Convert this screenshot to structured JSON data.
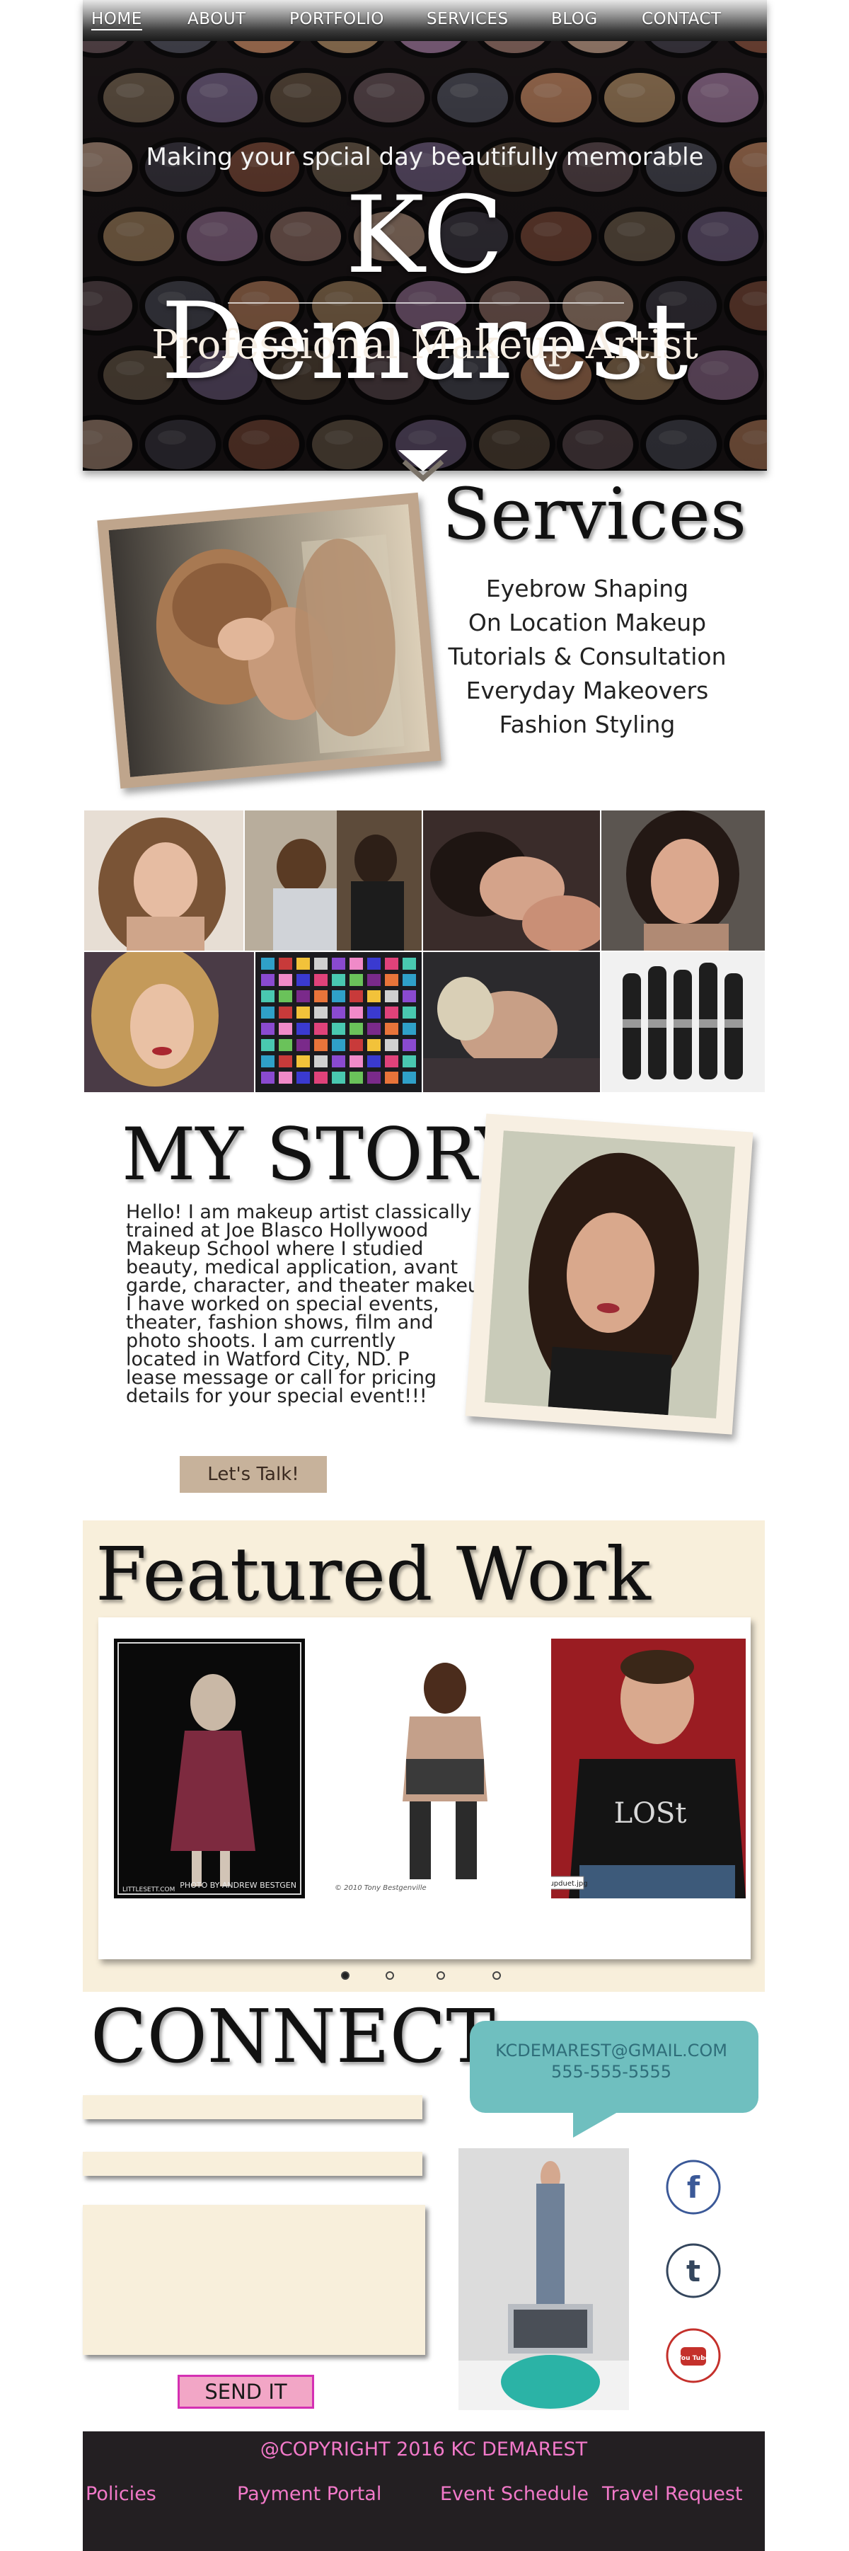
{
  "nav": {
    "items": [
      {
        "label": "HOME"
      },
      {
        "label": "ABOUT"
      },
      {
        "label": "PORTFOLIO"
      },
      {
        "label": "SERVICES"
      },
      {
        "label": "BLOG"
      },
      {
        "label": "CONTACT"
      }
    ],
    "active": "HOME"
  },
  "hero": {
    "tagline": "Making your spcial day beautifully memorable",
    "title": "KC Demarest",
    "subtitle": "Professional Makeup Artist"
  },
  "services": {
    "title": "Services",
    "items": [
      "Eyebrow Shaping",
      "On Location Makeup",
      "Tutorials & Consultation",
      "Everyday Makeovers",
      "Fashion Styling"
    ]
  },
  "story": {
    "title": "MY STORY",
    "lines": [
      "Hello! I am makeup artist classically",
      "trained at Joe Blasco Hollywood",
      "Makeup School where I studied",
      "beauty, medical application, avant",
      " garde, character, and theater makeup.",
      "I have worked on special events,",
      "theater, fashion shows, film and",
      " photo shoots. I am currently",
      "located in Watford City, ND. P",
      "lease message or call for pricing",
      "details for your special event!!!"
    ],
    "button_label": "Let's Talk!"
  },
  "featured": {
    "title": "Featured Work",
    "slides": [
      {
        "caption_left": "LITTLESETT.COM",
        "caption_right": "PHOTO BY ANDREW BESTGEN"
      },
      {
        "caption": "© 2010  Tony Bestgenville"
      },
      {
        "caption": "makeupduet.jpg"
      }
    ],
    "dot_count": 4,
    "active_dot": 0
  },
  "connect": {
    "title": "CONNECT",
    "email": "KCDEMAREST@GMAIL.COM",
    "phone": "555-555-5555",
    "send_label": "SEND IT",
    "social": [
      {
        "icon": "facebook-icon",
        "glyph": "f",
        "color": "#3b5998"
      },
      {
        "icon": "tumblr-icon",
        "glyph": "t",
        "color": "#34465d"
      },
      {
        "icon": "youtube-icon",
        "glyph": "You Tube",
        "color": "#c4302b"
      }
    ]
  },
  "footer": {
    "copyright": "@COPYRIGHT 2016  KC DEMAREST",
    "links": [
      "Policies",
      "Payment Portal",
      "Event Schedule",
      "Travel Request"
    ]
  },
  "colors": {
    "accent_pink": "#f279c9",
    "cream": "#f8efdb",
    "tan_button": "#c7b29b",
    "teal_bubble": "#6fbfbf",
    "footer_bg": "#231f22"
  }
}
